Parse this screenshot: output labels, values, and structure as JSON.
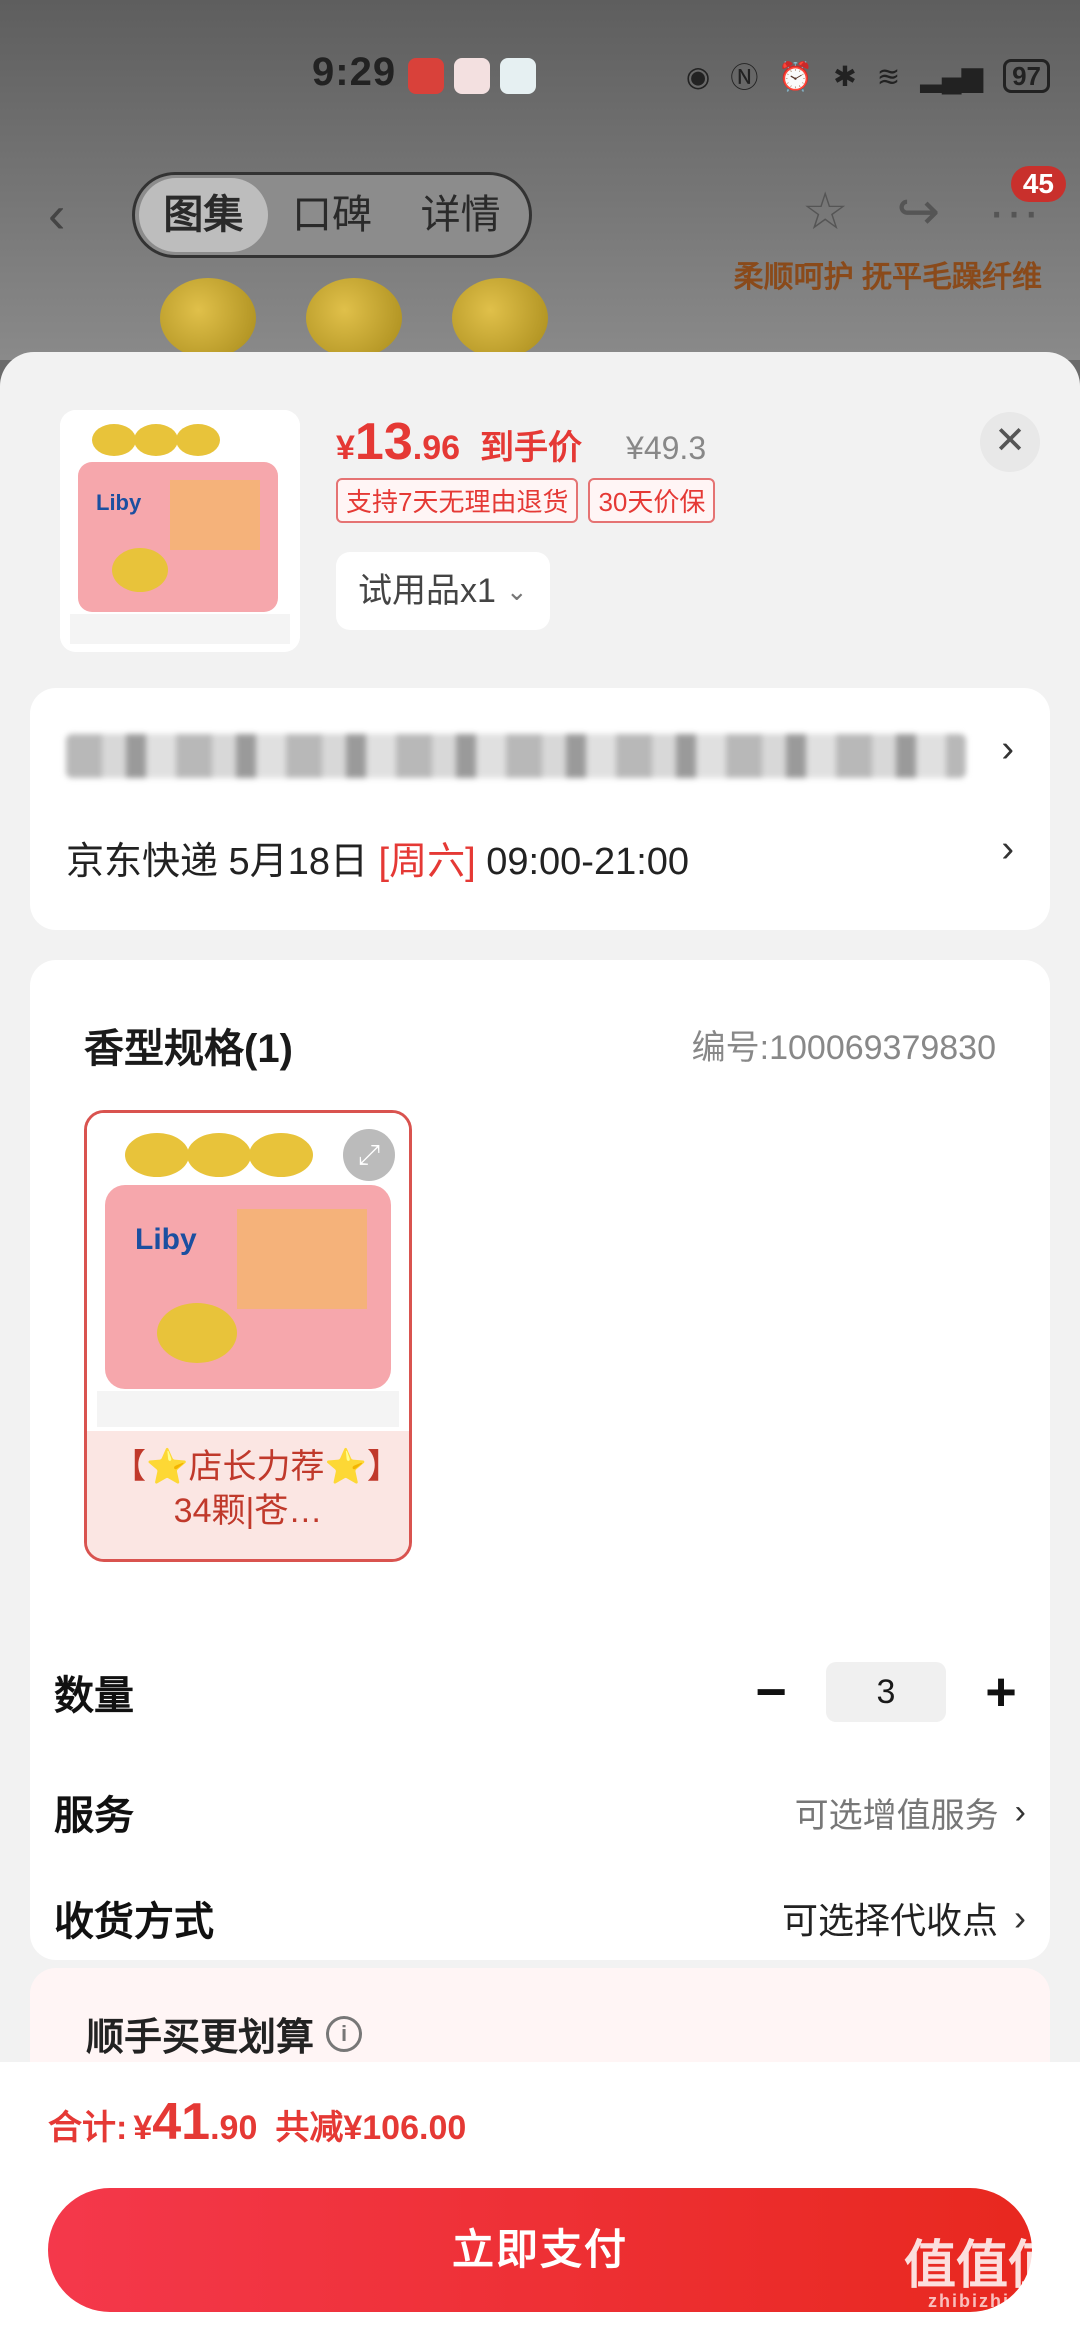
{
  "status_bar": {
    "time": "9:29",
    "battery": "97"
  },
  "background": {
    "tabs": [
      "图集",
      "口碑",
      "详情"
    ],
    "badge_count": "45",
    "banner_text": "柔顺呵护 抚平毛躁纤维"
  },
  "product": {
    "price_yen": "¥",
    "price_int": "13",
    "price_dec": ".96",
    "price_tag": "到手价",
    "original_price": "¥49.3",
    "tags": [
      "支持7天无理由退货",
      "30天价保"
    ],
    "variant": "试用品x1"
  },
  "shipping": {
    "carrier_date": "京东快递 5月18日 ",
    "weekday": "[周六]",
    "time_range": " 09:00-21:00"
  },
  "spec": {
    "title": "香型规格(1)",
    "code": "编号:100069379830",
    "item_label": "【⭐店长力荐⭐】34颗|苍…"
  },
  "options": {
    "quantity_label": "数量",
    "quantity_value": "3",
    "service_label": "服务",
    "service_value": "可选增值服务",
    "delivery_label": "收货方式",
    "delivery_value": "可选择代收点"
  },
  "addon": {
    "title": "顺手买更划算"
  },
  "footer": {
    "total_label": "合计:",
    "total_yen": "¥",
    "total_int": "41",
    "total_dec": ".90",
    "total_save": "共减¥106.00",
    "pay_label": "立即支付"
  },
  "watermark": {
    "line1": "值值值",
    "line2": "zhibizhi.com"
  },
  "colors": {
    "accent": "#e53935",
    "button": "#f4384b"
  }
}
